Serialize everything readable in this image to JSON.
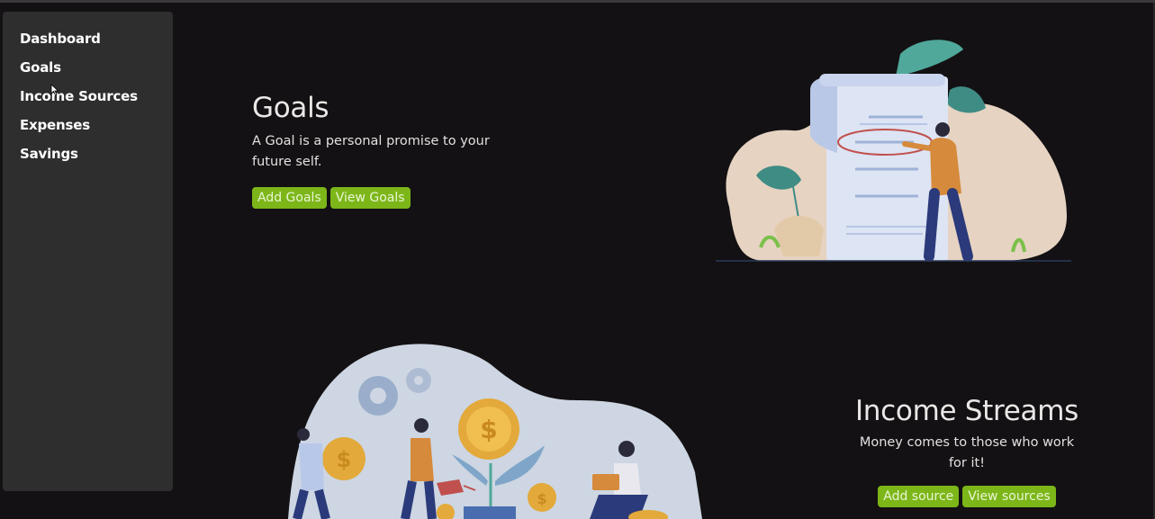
{
  "sidebar": {
    "items": [
      {
        "label": "Dashboard"
      },
      {
        "label": "Goals"
      },
      {
        "label": "Income Sources"
      },
      {
        "label": "Expenses"
      },
      {
        "label": "Savings"
      }
    ]
  },
  "goals": {
    "title": "Goals",
    "description": "A Goal is a personal promise to your future self.",
    "add_label": "Add Goals",
    "view_label": "View Goals"
  },
  "income": {
    "title": "Income Streams",
    "description": "Money comes to those who work for it!",
    "add_label": "Add source",
    "view_label": "View sources"
  },
  "colors": {
    "background": "#131113",
    "sidebar": "#2f2e2e",
    "accent_green": "#7cb619",
    "text": "#ebe7e7"
  }
}
